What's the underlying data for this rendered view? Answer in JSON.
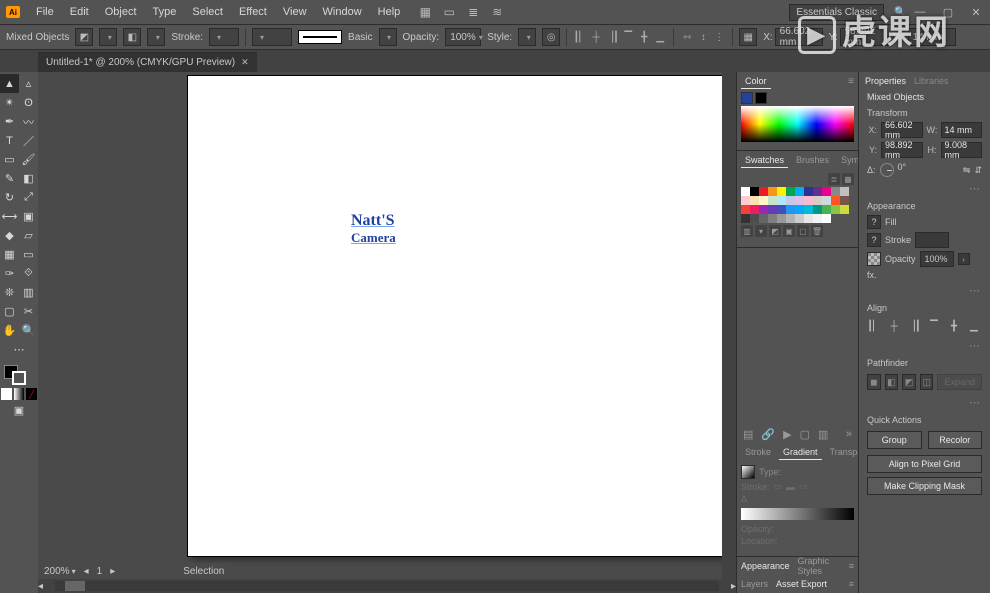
{
  "menubar": {
    "items": [
      "File",
      "Edit",
      "Object",
      "Type",
      "Select",
      "Effect",
      "View",
      "Window",
      "Help"
    ],
    "workspace": "Essentials Classic"
  },
  "optbar": {
    "selection_label": "Mixed Objects",
    "stroke_label": "Stroke:",
    "style_preset": "Basic",
    "opacity_label": "Opacity:",
    "opacity_value": "100%",
    "style_label": "Style:",
    "x_label": "X:",
    "x_value": "66.602 mm",
    "y_label": "Y:",
    "y_value": "98.892 mm",
    "w_label": "W:",
    "w_value": "14 mm"
  },
  "doc_tab": {
    "title": "Untitled-1* @ 200% (CMYK/GPU Preview)"
  },
  "artboard_text": {
    "line1": "Natt'S",
    "line2": "Camera"
  },
  "status": {
    "zoom": "200%",
    "nav": "1",
    "selection": "Selection"
  },
  "panels": {
    "color_tab": "Color",
    "swatches_tabs": [
      "Swatches",
      "Brushes",
      "Symbols"
    ],
    "stroke_tabs": [
      "Stroke",
      "Gradient",
      "Transparency"
    ],
    "gradient": {
      "type_label": "Type:",
      "stroke_label": "Stroke:",
      "angle_sym": "Δ",
      "opacity_label": "Opacity:",
      "location_label": "Location:"
    },
    "bottom_tabs1": [
      "Appearance",
      "Graphic Styles"
    ],
    "bottom_tabs2": [
      "Layers",
      "Asset Export"
    ]
  },
  "props": {
    "tabs": [
      "Properties",
      "Libraries"
    ],
    "selection_kind": "Mixed Objects",
    "transform_label": "Transform",
    "x_label": "X:",
    "x_value": "66.602 mm",
    "y_label": "Y:",
    "y_value": "98.892 mm",
    "w_label": "W:",
    "w_value": "14 mm",
    "h_label": "H:",
    "h_value": "9.008 mm",
    "angle_label": "Δ:",
    "angle_value": "0°",
    "appearance_label": "Appearance",
    "fill_label": "Fill",
    "stroke_label": "Stroke",
    "opacity_label": "Opacity",
    "opacity_value": "100%",
    "fx_label": "fx.",
    "align_label": "Align",
    "pathfinder_label": "Pathfinder",
    "expand_label": "Expand",
    "quick_actions_label": "Quick Actions",
    "group_btn": "Group",
    "recolor_btn": "Recolor",
    "align_pixel_btn": "Align to Pixel Grid",
    "clip_btn": "Make Clipping Mask"
  },
  "watermark": "虎课网"
}
